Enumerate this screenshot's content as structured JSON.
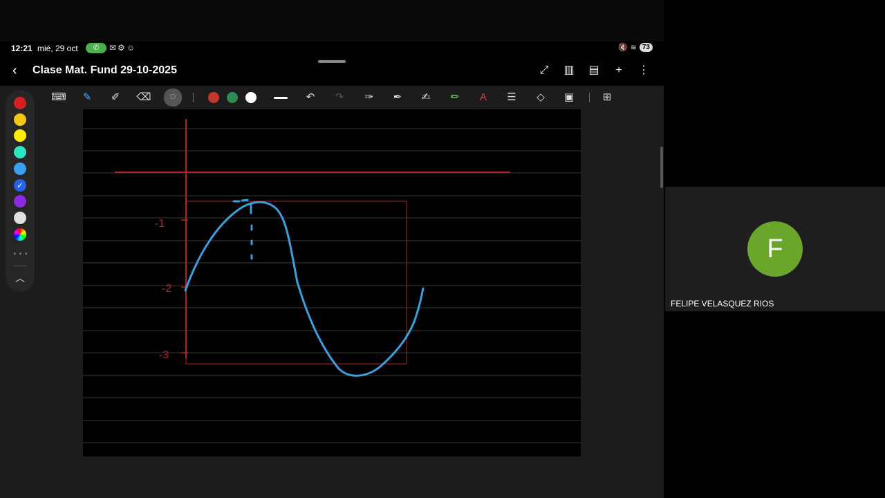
{
  "status_bar": {
    "time": "12:21",
    "date": "mié, 29 oct",
    "battery": "73"
  },
  "note": {
    "title": "Clase Mat. Fund 29-10-2025"
  },
  "toolbar": {
    "colors": [
      "#c0392b",
      "#2e8b57",
      "#ffffff"
    ]
  },
  "palette": {
    "swatches": [
      "#d62020",
      "#f5c518",
      "#ffee00",
      "#2ee6c2",
      "#3ba0f5",
      "#2563eb",
      "#8a2be2",
      "#e0e0e0"
    ],
    "selected_index": 5
  },
  "drawing": {
    "axis_color": "#b3261e",
    "curve_color": "#3aa0e0",
    "labels": [
      "-1",
      "-2",
      "-3"
    ]
  },
  "participant": {
    "initial": "F",
    "name": "FELIPE VELASQUEZ RIOS",
    "avatar_color": "#6aa52c"
  }
}
